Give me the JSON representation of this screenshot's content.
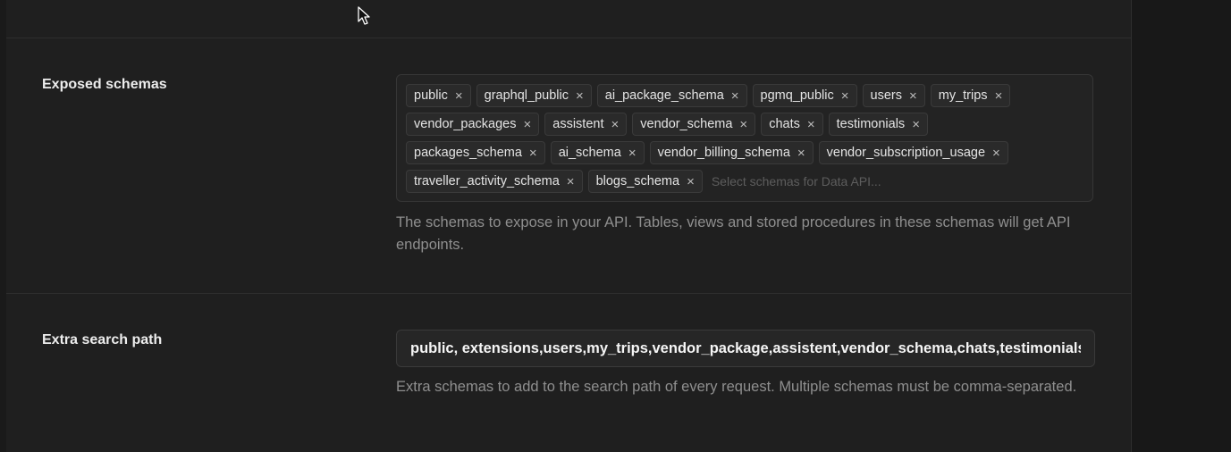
{
  "exposed_schemas": {
    "label": "Exposed schemas",
    "tag_rows": [
      [
        {
          "label": "public"
        },
        {
          "label": "graphql_public"
        },
        {
          "label": "ai_package_schema"
        },
        {
          "label": "pgmq_public"
        },
        {
          "label": "users"
        },
        {
          "label": "my_trips"
        }
      ],
      [
        {
          "label": "vendor_packages"
        },
        {
          "label": "assistent"
        },
        {
          "label": "vendor_schema"
        },
        {
          "label": "chats"
        },
        {
          "label": "testimonials"
        }
      ],
      [
        {
          "label": "packages_schema"
        },
        {
          "label": "ai_schema"
        },
        {
          "label": "vendor_billing_schema"
        },
        {
          "label": "vendor_subscription_usage"
        }
      ],
      [
        {
          "label": "traveller_activity_schema"
        },
        {
          "label": "blogs_schema"
        }
      ]
    ],
    "remove_glyph": "×",
    "input_placeholder": "Select schemas for Data API...",
    "help_text": "The schemas to expose in your API. Tables, views and stored procedures in these schemas will get API endpoints."
  },
  "extra_search_path": {
    "label": "Extra search path",
    "value": "public, extensions,users,my_trips,vendor_package,assistent,vendor_schema,chats,testimonials,",
    "help_text": "Extra schemas to add to the search path of every request. Multiple schemas must be comma-separated."
  },
  "icons": {
    "cursor": "mouse-pointer-icon",
    "remove": "close-icon"
  },
  "colors": {
    "background": "#1f1f1f",
    "tag_background": "#2a2a2a",
    "border": "#363636",
    "help_text": "#8f8f8f"
  }
}
